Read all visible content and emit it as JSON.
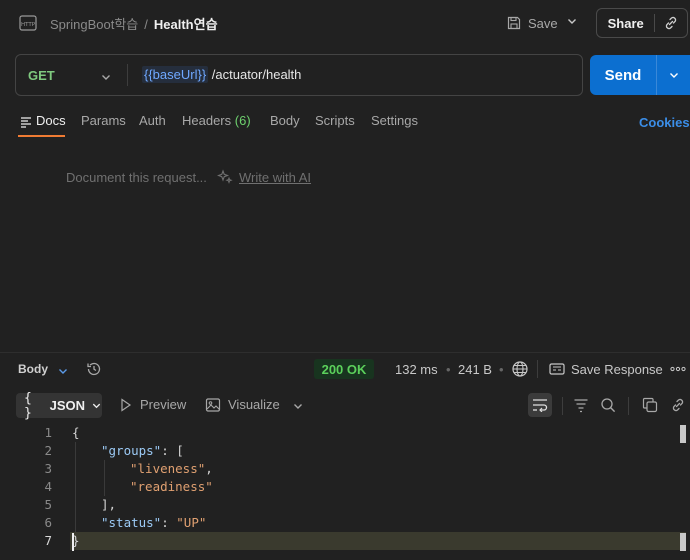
{
  "header": {
    "collection": "SpringBoot학습",
    "separator": "/",
    "request_name": "Health연습",
    "save_label": "Save",
    "share_label": "Share"
  },
  "request": {
    "method": "GET",
    "url_variable": "{{baseUrl}}",
    "url_path": " /actuator/health",
    "send_label": "Send"
  },
  "tabs": {
    "docs": "Docs",
    "params": "Params",
    "auth": "Auth",
    "headers": "Headers",
    "headers_count": "(6)",
    "body": "Body",
    "scripts": "Scripts",
    "settings": "Settings",
    "cookies": "Cookies"
  },
  "docs_panel": {
    "placeholder": "Document this request...",
    "ai_link": "Write with AI"
  },
  "response": {
    "body_label": "Body",
    "status": "200 OK",
    "time": "132 ms",
    "size": "241 B",
    "save_response": "Save Response",
    "format": "JSON",
    "format_icon": "{ }",
    "preview": "Preview",
    "visualize": "Visualize"
  },
  "code_lines": [
    {
      "n": "1",
      "text": "{"
    },
    {
      "n": "2",
      "key": "\"groups\"",
      "rest": ": ["
    },
    {
      "n": "3",
      "str": "\"liveness\"",
      "rest": ","
    },
    {
      "n": "4",
      "str": "\"readiness\""
    },
    {
      "n": "5",
      "text": "],"
    },
    {
      "n": "6",
      "key": "\"status\"",
      "rest": ": ",
      "str": "\"UP\""
    },
    {
      "n": "7",
      "text": "}"
    }
  ],
  "colors": {
    "accent_blue": "#0c6fd0",
    "method_green": "#7fc97f",
    "status_green": "#5bd05b",
    "tab_underline": "#f07b33",
    "json_key": "#9ccaf5",
    "json_string": "#e0a071"
  },
  "icons": {
    "http": "http-file-icon",
    "save": "floppy-disk-icon",
    "link": "link-icon",
    "history": "history-icon",
    "globe": "globe-icon",
    "wrap": "word-wrap-icon",
    "filter": "filter-icon",
    "search": "search-icon",
    "copy": "copy-icon"
  }
}
